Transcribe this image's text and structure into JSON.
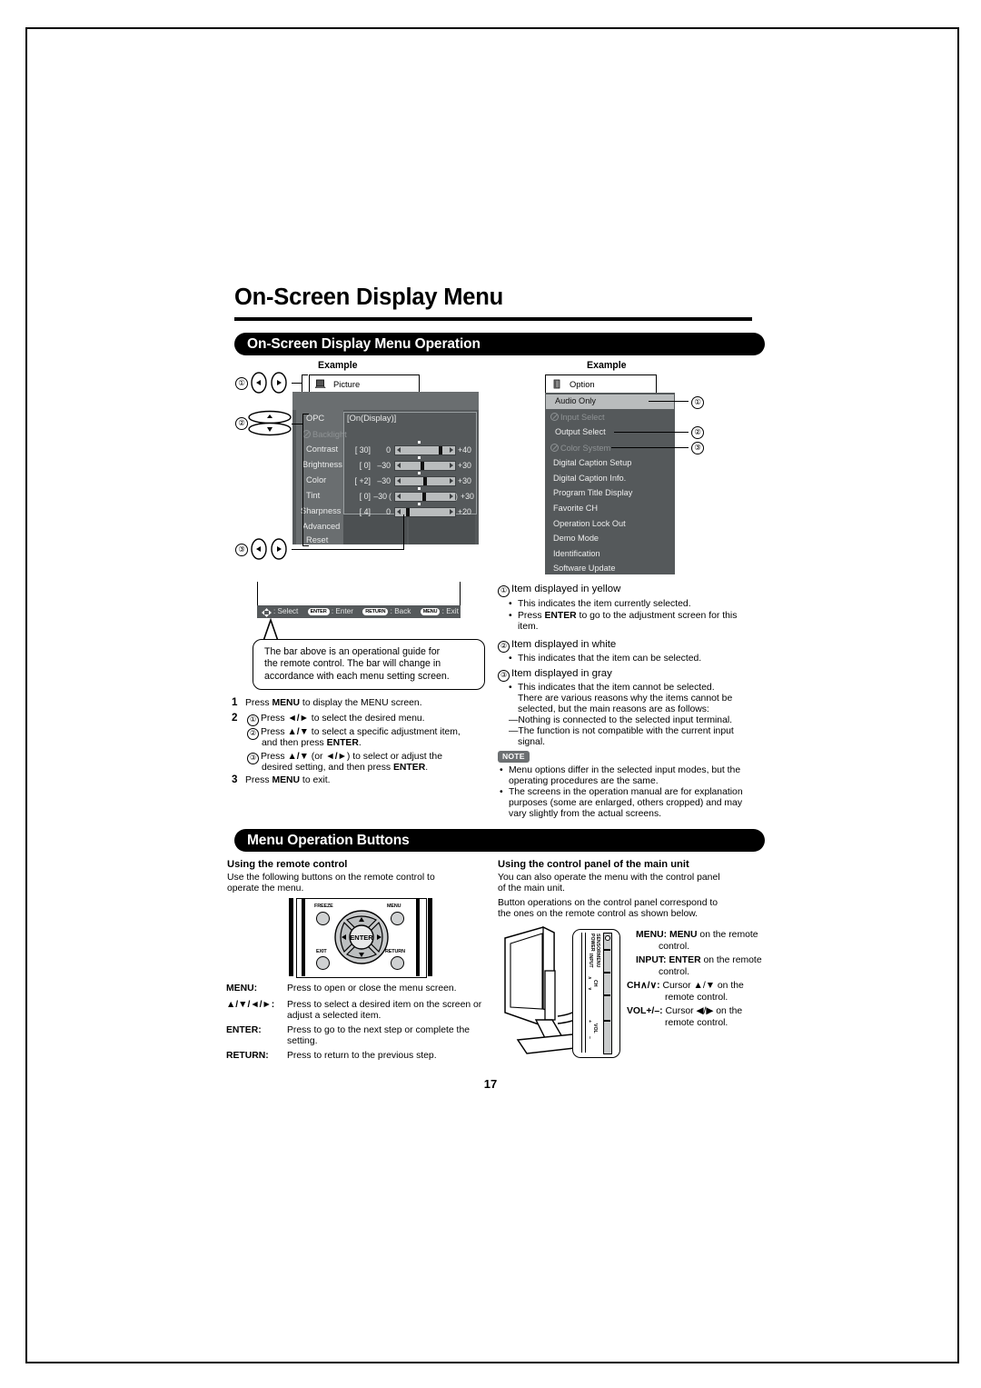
{
  "page": {
    "number": "17",
    "title": "On-Screen Display Menu"
  },
  "sections": {
    "osd_operation": {
      "band_title": "On-Screen Display Menu Operation"
    },
    "menu_buttons": {
      "band_title": "Menu Operation Buttons"
    }
  },
  "examples": {
    "left_label": "Example",
    "right_label": "Example"
  },
  "picture_menu": {
    "tab_label": "Picture",
    "items": [
      {
        "label": "OPC",
        "value": "[On(Display)]",
        "state": "white"
      },
      {
        "label": "Backlight",
        "value": "",
        "state": "gray"
      },
      {
        "label": "Contrast",
        "value": "[  30]",
        "min": "0",
        "max": "+40",
        "state": "white"
      },
      {
        "label": "Brightness",
        "value": "[    0]",
        "min": "–30",
        "max": "+30",
        "state": "white"
      },
      {
        "label": "Color",
        "value": "[  +2]",
        "min": "–30",
        "max": "+30",
        "state": "white"
      },
      {
        "label": "Tint",
        "value": "[    0]",
        "min": "–30",
        "max": "+30",
        "state": "white"
      },
      {
        "label": "Sharpness",
        "value": "[    4]",
        "min": "0",
        "max": "+20",
        "state": "white"
      },
      {
        "label": "Advanced",
        "value": "",
        "state": "white"
      },
      {
        "label": "Reset",
        "value": "",
        "state": "white"
      }
    ],
    "guide_bar": {
      "select": ": Select",
      "enter_key": "ENTER",
      "enter_text": ": Enter",
      "return_key": "RETURN",
      "return_text": ": Back",
      "menu_key": "MENU",
      "menu_text": ": Exit"
    }
  },
  "option_menu": {
    "tab_label": "Option",
    "items": [
      {
        "label": "Audio Only",
        "state": "selected"
      },
      {
        "label": "Input Select",
        "state": "gray"
      },
      {
        "label": "Output Select",
        "state": "white"
      },
      {
        "label": "Color System",
        "state": "gray"
      },
      {
        "label": "Digital Caption Setup",
        "state": "white"
      },
      {
        "label": "Digital Caption Info.",
        "state": "white"
      },
      {
        "label": "Program Title Display",
        "state": "white"
      },
      {
        "label": "Favorite CH",
        "state": "white"
      },
      {
        "label": "Operation Lock Out",
        "state": "white"
      },
      {
        "label": "Demo Mode",
        "state": "white"
      },
      {
        "label": "Identification",
        "state": "white"
      },
      {
        "label": "Software Update",
        "state": "white"
      }
    ]
  },
  "callout": {
    "line1": "The bar above is an operational guide for",
    "line2": "the remote control. The bar will change in",
    "line3": "accordance with each menu setting screen."
  },
  "steps": {
    "s1_num": "1",
    "s1_text_a": "Press ",
    "s1_bold": "MENU",
    "s1_text_b": " to display the MENU screen.",
    "s2_num": "2",
    "s2_1_a": "Press ",
    "s2_1_b": " to select the desired menu.",
    "s2_2_a": "Press ",
    "s2_2_b": " to select a specific adjustment item,",
    "s2_2_c": "and then press ",
    "s2_2_bold": "ENTER",
    "s2_2_d": ".",
    "s2_3_a": "Press ",
    "s2_3_b": " (or ",
    "s2_3_c": ") to select or adjust the",
    "s2_3_d": "desired setting, and then press ",
    "s2_3_bold": "ENTER",
    "s2_3_e": ".",
    "s3_num": "3",
    "s3_text_a": "Press ",
    "s3_bold": "MENU",
    "s3_text_b": " to exit."
  },
  "legend": {
    "item1_title": "Item displayed in yellow",
    "item1_b1": "This indicates the item currently selected.",
    "item1_b2_a": "Press ",
    "item1_b2_bold": "ENTER",
    "item1_b2_b": " to go to the adjustment screen for this",
    "item1_b2_c": "item.",
    "item2_title": "Item displayed in white",
    "item2_b1": "This indicates that the item can be selected.",
    "item3_title": "Item displayed in gray",
    "item3_b1_l1": "This indicates that the item cannot be selected.",
    "item3_b1_l2": "There are various reasons why the items cannot be",
    "item3_b1_l3": "selected, but the main reasons are as follows:",
    "item3_d1": "—Nothing is connected to the selected input terminal.",
    "item3_d2_l1": "—The function is not compatible with the current input",
    "item3_d2_l2": "signal."
  },
  "note": {
    "badge": "NOTE",
    "b1_l1": "Menu options differ in the selected input modes, but the",
    "b1_l2": "operating procedures are the same.",
    "b2_l1": "The screens in the operation manual are for explanation",
    "b2_l2": "purposes (some are enlarged, others cropped) and may",
    "b2_l3": "vary slightly from the actual screens."
  },
  "remote_section": {
    "heading": "Using the remote control",
    "intro_l1": "Use the following buttons on the remote control to",
    "intro_l2": "operate the menu.",
    "remote_buttons": {
      "freeze": "FREEZE",
      "menu": "MENU",
      "exit": "EXIT",
      "return": "RETURN",
      "enter": "ENTER"
    },
    "table": [
      {
        "key": "MENU:",
        "desc_l1": "Press to open or close the menu screen.",
        "desc_l2": ""
      },
      {
        "key": "ARROWS:",
        "desc_l1": "Press to select a desired item on the screen or",
        "desc_l2": "adjust a selected item."
      },
      {
        "key": "ENTER:",
        "desc_l1": "Press to go to the next step or complete the",
        "desc_l2": "setting."
      },
      {
        "key": "RETURN:",
        "desc_l1": "Press to return to the previous step.",
        "desc_l2": ""
      }
    ]
  },
  "panel_section": {
    "heading": "Using the control panel of the main unit",
    "intro_l1": "You can also operate the menu with the control panel",
    "intro_l2": "of the main unit.",
    "intro_l3": "Button operations on the control panel correspond to",
    "intro_l4": "the ones on the remote control as shown below.",
    "panel_labels": [
      "POWER",
      "SENSOR",
      "MENU",
      "INPUT",
      "CH",
      "VOL",
      "+",
      "–"
    ],
    "ch_up": "∧",
    "ch_down": "∨",
    "mappings": [
      {
        "key": "MENU:",
        "bold2": "MENU",
        "rest_l1": " on the remote",
        "rest_l2": "control."
      },
      {
        "key": "INPUT:",
        "bold2": "ENTER",
        "rest_l1": " on the remote",
        "rest_l2": "control."
      },
      {
        "key": "CH∧/∨:",
        "bold2": "",
        "rest_l1": "Cursor ▲/▼ on the",
        "rest_l2": "remote control."
      },
      {
        "key": "VOL+/–:",
        "bold2": "",
        "rest_l1": "Cursor ◀/▶ on the",
        "rest_l2": "remote control."
      }
    ]
  },
  "markers": {
    "one": "①",
    "two": "②",
    "three": "③"
  },
  "colors": {
    "band": "#000000",
    "osd_panel": "#55595b",
    "osd_left": "#6a6e70",
    "osd_selected": "#b9bcbd",
    "osd_gray_text": "#8e9294",
    "note_badge": "#6c7072"
  }
}
